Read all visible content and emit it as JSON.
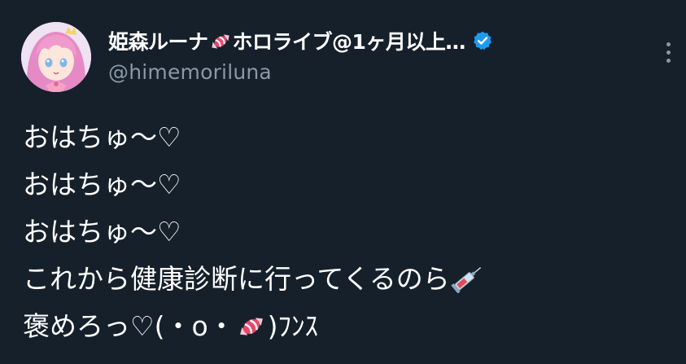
{
  "author": {
    "display_name_part1": "姫森ルーナ",
    "display_name_part2": "ホロライブ@1ヶ月以上…",
    "handle": "@himemoriluna",
    "verified": true
  },
  "icons": {
    "avatar": "avatar-image",
    "candy": "candy-emoji",
    "verified": "verified-badge-icon",
    "more": "more-options-icon",
    "syringe": "syringe-emoji"
  },
  "colors": {
    "background": "#15202b",
    "text": "#ffffff",
    "secondary_text": "#8b98a5",
    "verified_blue": "#1d9bf0"
  },
  "tweet": {
    "line1": "おはちゅ〜♡",
    "line2": "おはちゅ〜♡",
    "line3": "おはちゅ〜♡",
    "line4": "これから健康診断に行ってくるのら",
    "line5_part1": "褒めろっ♡(・o・",
    "line5_part2": ")ﾌﾝｽ"
  }
}
